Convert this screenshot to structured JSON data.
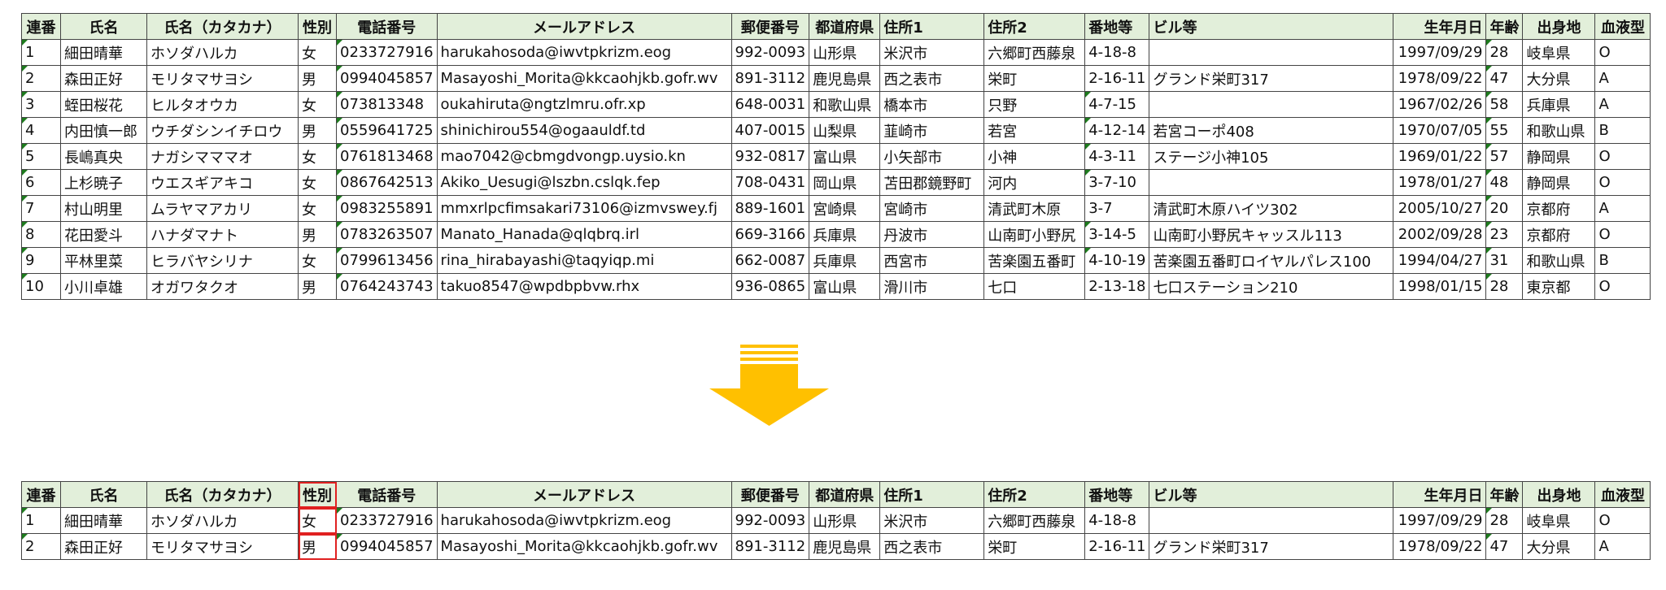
{
  "columns": [
    "連番",
    "氏名",
    "氏名（カタカナ）",
    "性別",
    "電話番号",
    "メールアドレス",
    "郵便番号",
    "都道府県",
    "住所1",
    "住所2",
    "番地等",
    "ビル等",
    "生年月日",
    "年齢",
    "出身地",
    "血液型"
  ],
  "rows": [
    [
      "1",
      "細田晴華",
      "ホソダハルカ",
      "女",
      "0233727916",
      "harukahosoda@iwvtpkrizm.eog",
      "992-0093",
      "山形県",
      "米沢市",
      "六郷町西藤泉",
      "4-18-8",
      "",
      "1997/09/29",
      "28",
      "岐阜県",
      "O"
    ],
    [
      "2",
      "森田正好",
      "モリタマサヨシ",
      "男",
      "0994045857",
      "Masayoshi_Morita@kkcaohjkb.gofr.wv",
      "891-3112",
      "鹿児島県",
      "西之表市",
      "栄町",
      "2-16-11",
      "グランド栄町317",
      "1978/09/22",
      "47",
      "大分県",
      "A"
    ],
    [
      "3",
      "蛭田桜花",
      "ヒルタオウカ",
      "女",
      "073813348",
      "oukahiruta@ngtzlmru.ofr.xp",
      "648-0031",
      "和歌山県",
      "橋本市",
      "只野",
      "4-7-15",
      "",
      "1967/02/26",
      "58",
      "兵庫県",
      "A"
    ],
    [
      "4",
      "内田慎一郎",
      "ウチダシンイチロウ",
      "男",
      "0559641725",
      "shinichirou554@ogaauldf.td",
      "407-0015",
      "山梨県",
      "韮崎市",
      "若宮",
      "4-12-14",
      "若宮コーポ408",
      "1970/07/05",
      "55",
      "和歌山県",
      "B"
    ],
    [
      "5",
      "長嶋真央",
      "ナガシマママオ",
      "女",
      "0761813468",
      "mao7042@cbmgdvongp.uysio.kn",
      "932-0817",
      "富山県",
      "小矢部市",
      "小神",
      "4-3-11",
      "ステージ小神105",
      "1969/01/22",
      "57",
      "静岡県",
      "O"
    ],
    [
      "6",
      "上杉暁子",
      "ウエスギアキコ",
      "女",
      "0867642513",
      "Akiko_Uesugi@lszbn.cslqk.fep",
      "708-0431",
      "岡山県",
      "苫田郡鏡野町",
      "河内",
      "3-7-10",
      "",
      "1978/01/27",
      "48",
      "静岡県",
      "O"
    ],
    [
      "7",
      "村山明里",
      "ムラヤマアカリ",
      "女",
      "0983255891",
      "mmxrlpcfimsakari73106@izmvswey.fj",
      "889-1601",
      "宮崎県",
      "宮崎市",
      "清武町木原",
      "3-7",
      "清武町木原ハイツ302",
      "2005/10/27",
      "20",
      "京都府",
      "A"
    ],
    [
      "8",
      "花田愛斗",
      "ハナダマナト",
      "男",
      "0783263507",
      "Manato_Hanada@qlqbrq.irl",
      "669-3166",
      "兵庫県",
      "丹波市",
      "山南町小野尻",
      "3-14-5",
      "山南町小野尻キャッスル113",
      "2002/09/28",
      "23",
      "京都府",
      "O"
    ],
    [
      "9",
      "平林里菜",
      "ヒラバヤシリナ",
      "女",
      "0799613456",
      "rina_hirabayashi@taqyiqp.mi",
      "662-0087",
      "兵庫県",
      "西宮市",
      "苦楽園五番町",
      "4-10-19",
      "苦楽園五番町ロイヤルパレス100",
      "1994/04/27",
      "31",
      "和歌山県",
      "B"
    ],
    [
      "10",
      "小川卓雄",
      "オガワタクオ",
      "男",
      "0764243743",
      "takuo8547@wpdbpbvw.rhx",
      "936-0865",
      "富山県",
      "滑川市",
      "七口",
      "2-13-18",
      "七口ステーション210",
      "1998/01/15",
      "28",
      "東京都",
      "O"
    ]
  ],
  "bottom_rows": [
    [
      "1",
      "細田晴華",
      "ホソダハルカ",
      "女",
      "0233727916",
      "harukahosoda@iwvtpkrizm.eog",
      "992-0093",
      "山形県",
      "米沢市",
      "六郷町西藤泉",
      "4-18-8",
      "",
      "1997/09/29",
      "28",
      "岐阜県",
      "O"
    ],
    [
      "2",
      "森田正好",
      "モリタマサヨシ",
      "男",
      "0994045857",
      "Masayoshi_Morita@kkcaohjkb.gofr.wv",
      "891-3112",
      "鹿児島県",
      "西之表市",
      "栄町",
      "2-16-11",
      "グランド栄町317",
      "1978/09/22",
      "47",
      "大分県",
      "A"
    ]
  ],
  "colors": {
    "header_bg": "#e2efda",
    "arrow": "#ffc000",
    "highlight": "#e02020",
    "triangle": "#1e7b1e"
  },
  "arrow_icon": "down-arrow-icon"
}
